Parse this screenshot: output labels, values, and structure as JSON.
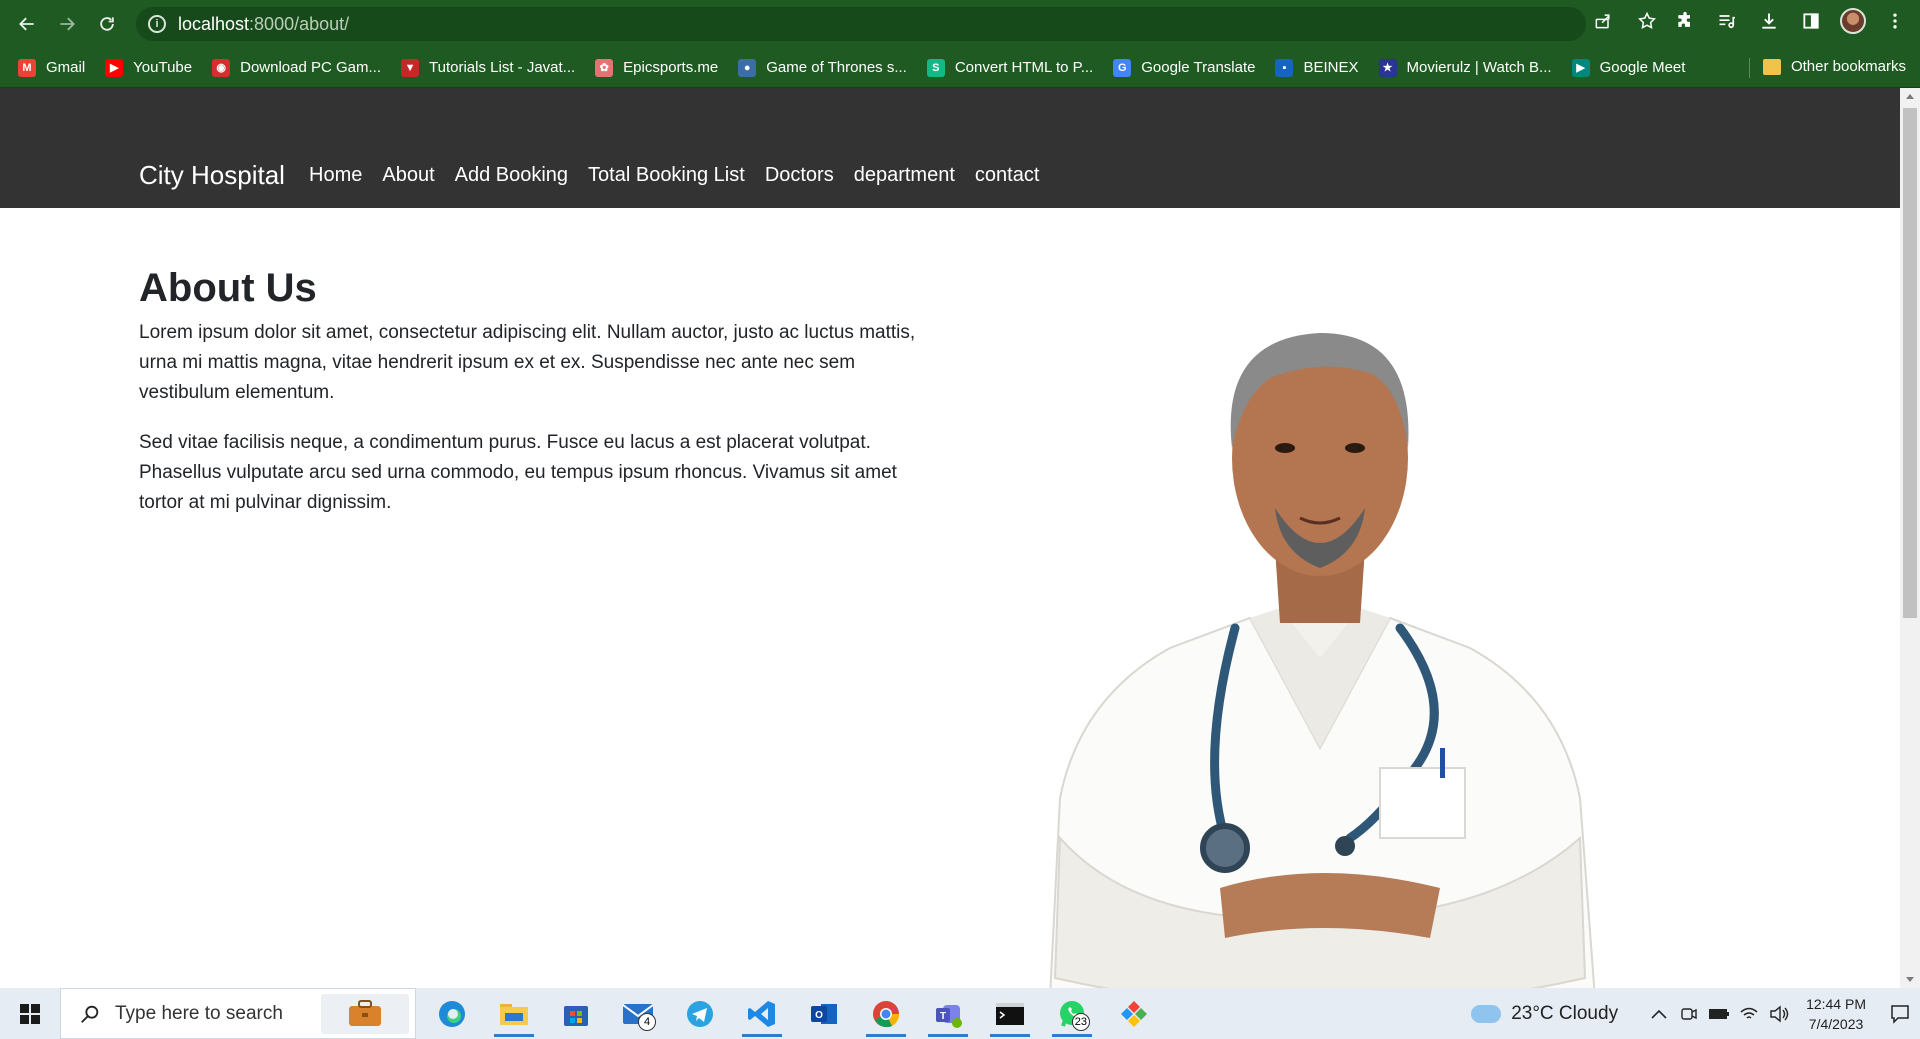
{
  "browser": {
    "url_host": "localhost",
    "url_rest": ":8000/about/",
    "bookmarks": [
      {
        "label": "Gmail",
        "icon": "gmail-icon",
        "color": "#ea4335",
        "glyph": "M"
      },
      {
        "label": "YouTube",
        "icon": "youtube-icon",
        "color": "#ff0000",
        "glyph": "▶"
      },
      {
        "label": "Download PC Gam...",
        "icon": "game-site-icon",
        "color": "#d32f2f",
        "glyph": "◉"
      },
      {
        "label": "Tutorials List - Javat...",
        "icon": "javatpoint-icon",
        "color": "#c62828",
        "glyph": "▼"
      },
      {
        "label": "Epicsports.me",
        "icon": "epicsports-icon",
        "color": "#e57373",
        "glyph": "✿"
      },
      {
        "label": "Game of Thrones s...",
        "icon": "globe-icon",
        "color": "#3b6ea5",
        "glyph": "●"
      },
      {
        "label": "Convert HTML to P...",
        "icon": "convert-icon",
        "color": "#12b886",
        "glyph": "S"
      },
      {
        "label": "Google Translate",
        "icon": "google-translate-icon",
        "color": "#4285f4",
        "glyph": "G"
      },
      {
        "label": "BEINEX",
        "icon": "beinex-icon",
        "color": "#1565c0",
        "glyph": "▪"
      },
      {
        "label": "Movierulz | Watch B...",
        "icon": "movierulz-icon",
        "color": "#283593",
        "glyph": "★"
      },
      {
        "label": "Google Meet",
        "icon": "google-meet-icon",
        "color": "#00897b",
        "glyph": "▶"
      }
    ],
    "other_bookmarks": "Other bookmarks"
  },
  "site": {
    "brand": "City Hospital",
    "nav": [
      "Home",
      "About",
      "Add Booking",
      "Total Booking List",
      "Doctors",
      "department",
      "contact"
    ]
  },
  "about": {
    "title": "About Us",
    "p1": "Lorem ipsum dolor sit amet, consectetur adipiscing elit. Nullam auctor, justo ac luctus mattis, urna mi mattis magna, vitae hendrerit ipsum ex et ex. Suspendisse nec ante nec sem vestibulum elementum.",
    "p2": "Sed vitae facilisis neque, a condimentum purus. Fusce eu lacus a est placerat volutpat. Phasellus vulputate arcu sed urna commodo, eu tempus ipsum rhoncus. Vivamus sit amet tortor at mi pulvinar dignissim."
  },
  "taskbar": {
    "search_placeholder": "Type here to search",
    "mail_badge": "4",
    "whatsapp_badge": "23",
    "weather": "23°C  Cloudy",
    "time": "12:44 PM",
    "date": "7/4/2023"
  }
}
